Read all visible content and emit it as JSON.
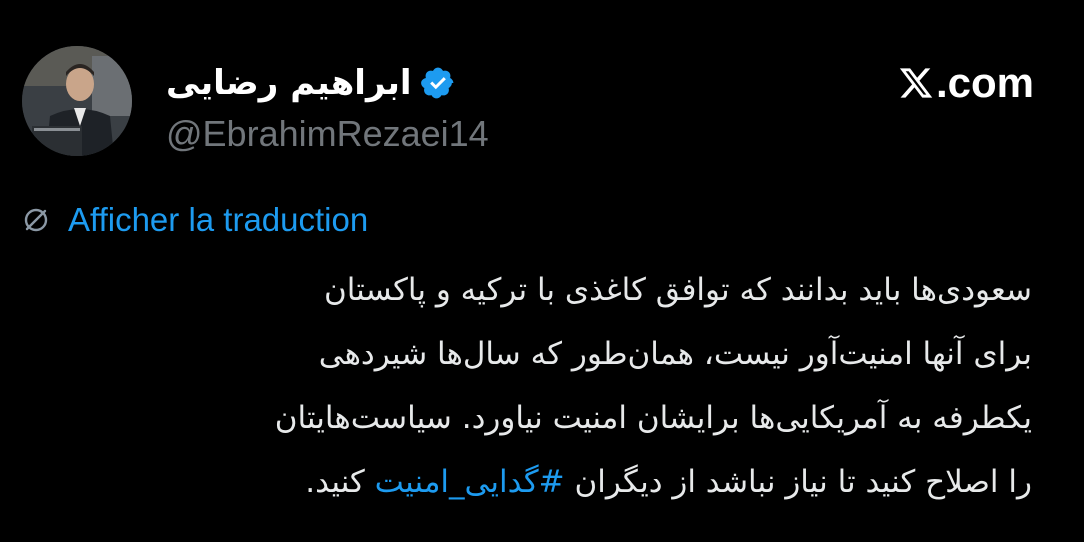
{
  "post": {
    "author": {
      "display_name": "ابراهیم رضایی",
      "handle": "@EbrahimRezaei14",
      "verified_badge_icon": "verified-badge-icon",
      "avatar_icon": "avatar-photo"
    },
    "site": {
      "logo_icon": "x-logo-icon",
      "domain_suffix": ".com"
    },
    "translation": {
      "icon": "globe-icon",
      "label": "Afficher la traduction"
    },
    "body": {
      "line_1": "سعودی‌ها باید بدانند که توافق کاغذی با ترکیه و پاکستان",
      "line_2": "برای آنها امنیت‌آور نیست، همان‌طور که سال‌ها شیردهی",
      "line_3": "یکطرفه به آمریکایی‌ها برایشان امنیت نیاورد. سیاست‌هایتان",
      "line_4_before": "را اصلاح کنید تا نیاز نباشد از دیگران ",
      "hashtag": "#گدایی_امنیت",
      "line_4_after": " کنید."
    }
  },
  "colors": {
    "background": "#000000",
    "text_primary": "#e7e9ea",
    "text_secondary": "#71767b",
    "accent_blue": "#1d9bf0"
  }
}
